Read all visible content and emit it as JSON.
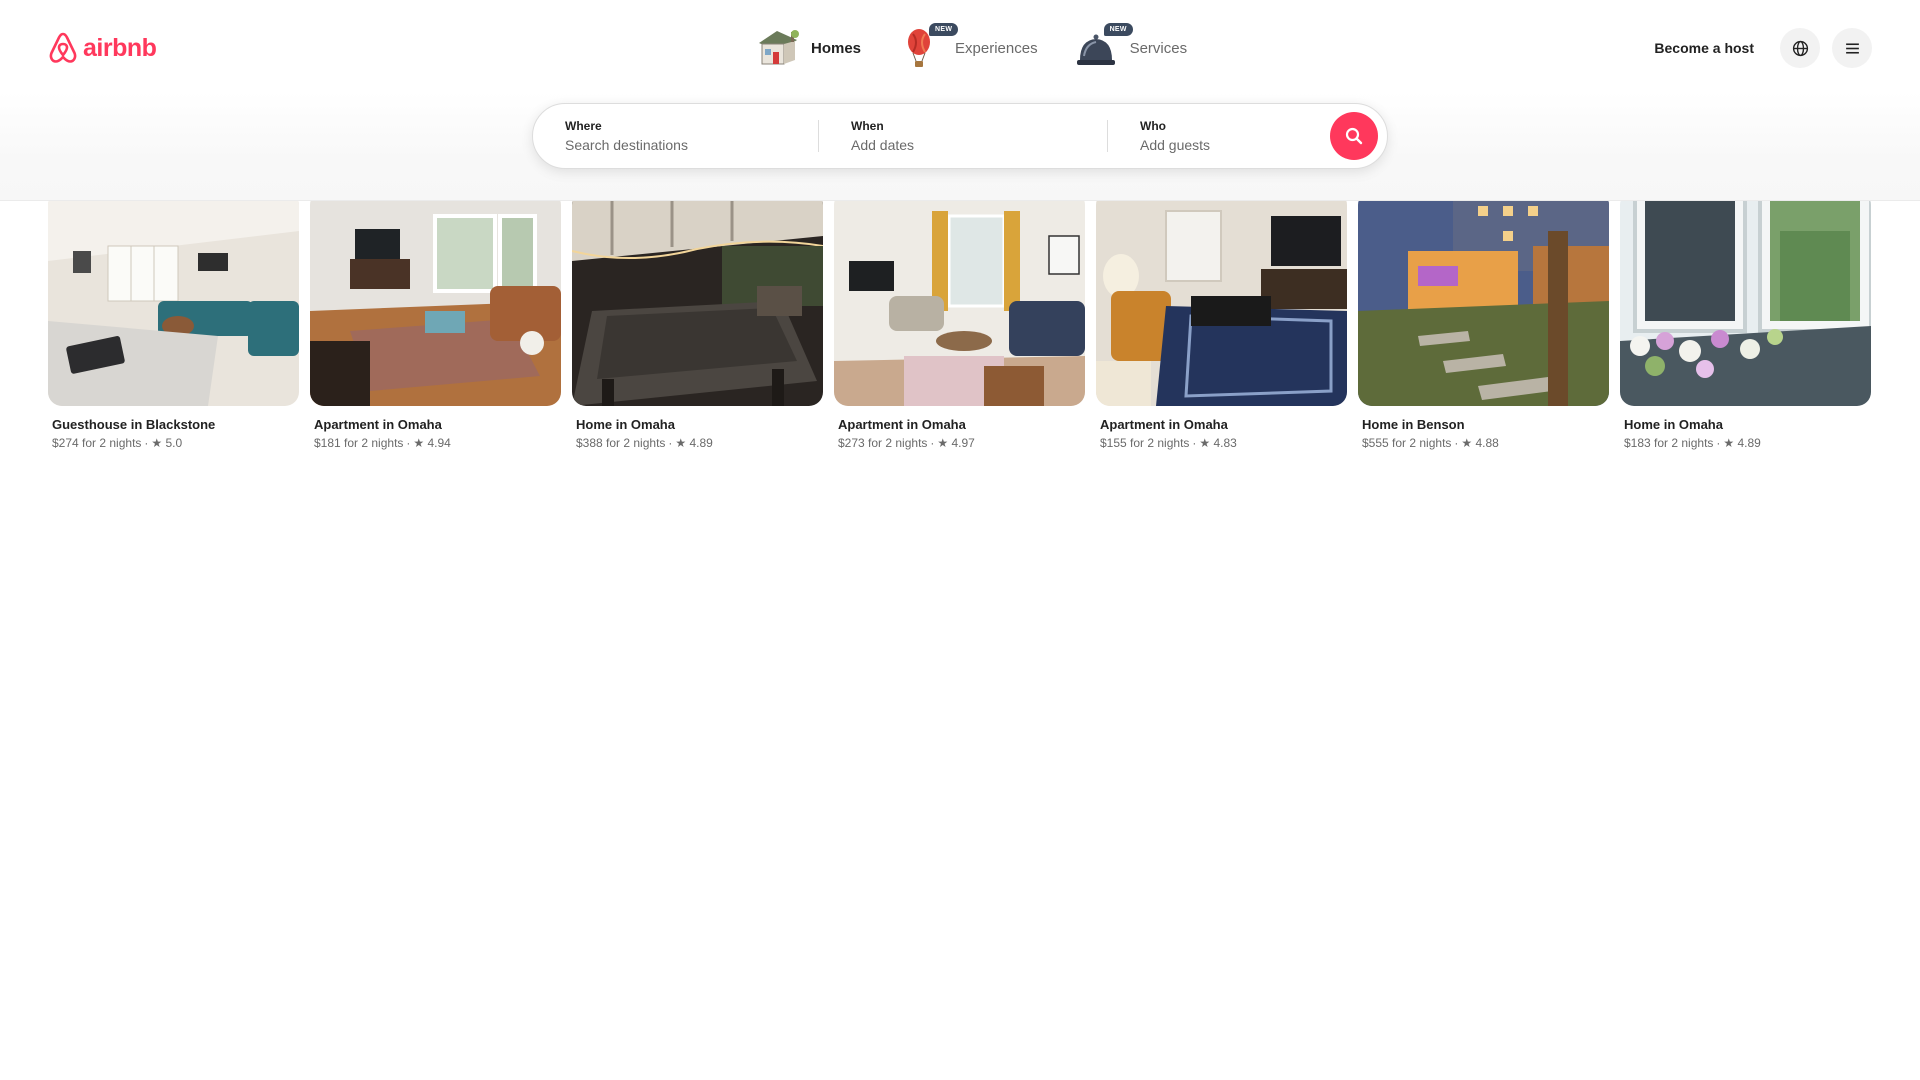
{
  "brand": {
    "name": "airbnb",
    "color": "#ff385c",
    "icon": "airbnb-logo-icon"
  },
  "nav": {
    "items": [
      {
        "label": "Homes",
        "icon": "house-icon",
        "active": true,
        "badge": ""
      },
      {
        "label": "Experiences",
        "icon": "hot-air-balloon-icon",
        "active": false,
        "badge": "NEW"
      },
      {
        "label": "Services",
        "icon": "service-bell-icon",
        "active": false,
        "badge": "NEW"
      }
    ]
  },
  "header_right": {
    "host_label": "Become a host",
    "language_icon": "globe-icon",
    "menu_icon": "hamburger-menu-icon"
  },
  "search": {
    "where": {
      "title": "Where",
      "placeholder": "Search destinations"
    },
    "when": {
      "title": "When",
      "placeholder": "Add dates"
    },
    "who": {
      "title": "Who",
      "placeholder": "Add guests"
    },
    "button_icon": "search-icon"
  },
  "listings": [
    {
      "title": "Guesthouse in Blackstone",
      "price": "$274 for 2 nights",
      "rating": "★ 5.0"
    },
    {
      "title": "Apartment in Omaha",
      "price": "$181 for 2 nights",
      "rating": "★ 4.94"
    },
    {
      "title": "Home in Omaha",
      "price": "$388 for 2 nights",
      "rating": "★ 4.89"
    },
    {
      "title": "Apartment in Omaha",
      "price": "$273 for 2 nights",
      "rating": "★ 4.97"
    },
    {
      "title": "Apartment in Omaha",
      "price": "$155 for 2 nights",
      "rating": "★ 4.83"
    },
    {
      "title": "Home in Benson",
      "price": "$555 for 2 nights",
      "rating": "★ 4.88"
    },
    {
      "title": "Home in Omaha",
      "price": "$183 for 2 nights",
      "rating": "★ 4.89"
    }
  ],
  "separator": "·"
}
